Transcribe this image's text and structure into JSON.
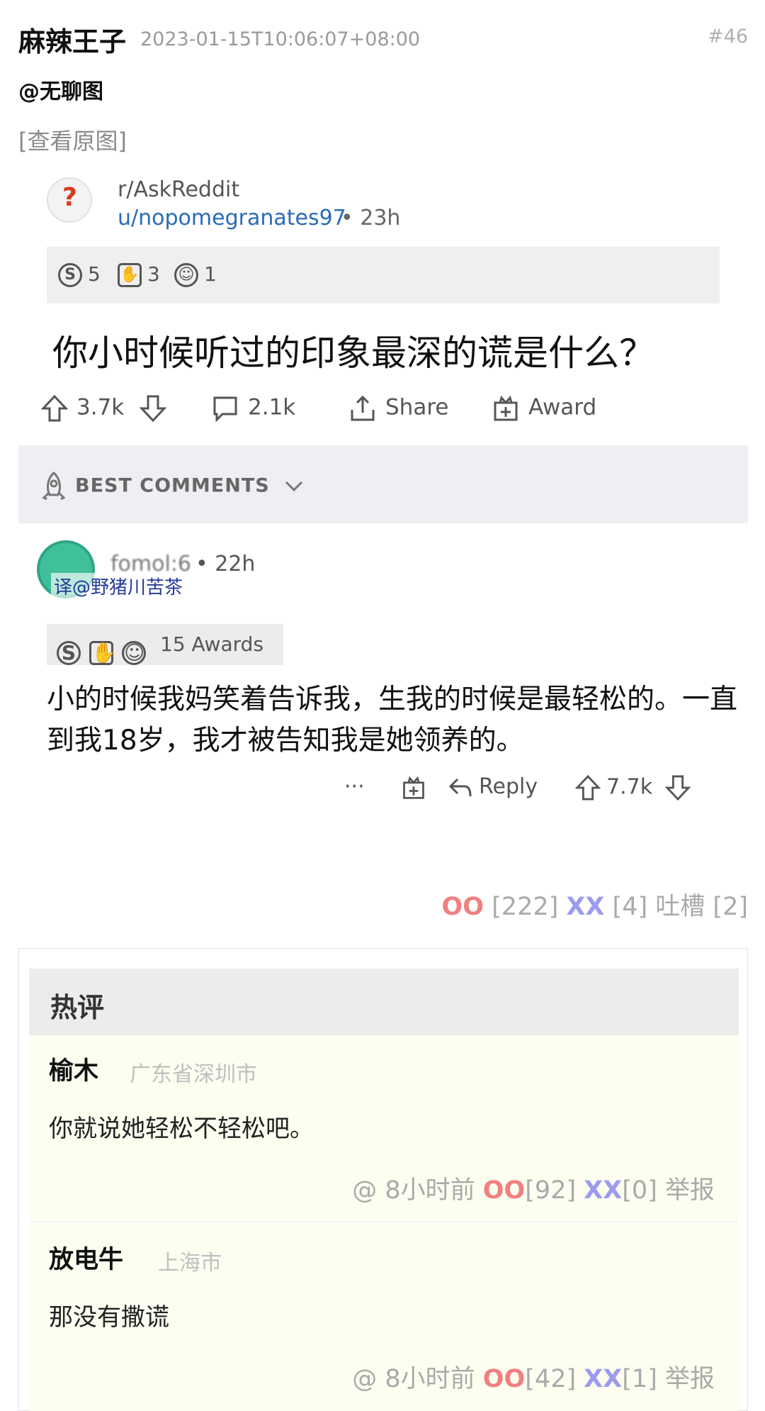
{
  "post": {
    "author": "麻辣王子",
    "timestamp": "2023-01-15T10:06:07+08:00",
    "number": "#46",
    "mention": "@无聊图",
    "view_original": "[查看原图]"
  },
  "reddit": {
    "subreddit": "r/AskReddit",
    "user": "u/nopomegranates97",
    "time": "• 23h",
    "awards": [
      {
        "icon": "silver-coin-icon",
        "count": "5"
      },
      {
        "icon": "helpful-award-icon",
        "count": "3"
      },
      {
        "icon": "wholesome-award-icon",
        "count": "1"
      }
    ],
    "question": "你小时候听过的印象最深的谎是什么？",
    "upvotes": "3.7k",
    "comments": "2.1k",
    "share": "Share",
    "award": "Award",
    "best_comments": "BEST COMMENTS",
    "comment": {
      "user_blur": "fomol:6",
      "time": "• 22h",
      "watermark": "译@野猪川苦茶",
      "awards_label": "15 Awards",
      "text": "小的时候我妈笑着告诉我，生我的时候是最轻松的。一直到我18岁，我才被告知我是她领养的。",
      "more": "···",
      "reply": "Reply",
      "votes": "7.7k"
    }
  },
  "votes": {
    "oo_label": "OO",
    "oo_count": "[222]",
    "xx_label": "XX",
    "xx_count": "[4]",
    "tucao_label": "吐槽",
    "tucao_count": "[2]"
  },
  "hot": {
    "title": "热评",
    "items": [
      {
        "name": "榆木",
        "location": "广东省深圳市",
        "text": "你就说她轻松不轻松吧。",
        "time": "@ 8小时前",
        "oo": "OO",
        "oo_count": "[92]",
        "xx": "XX",
        "xx_count": "[0]",
        "report": "举报"
      },
      {
        "name": "放电牛",
        "location": "上海市",
        "text": "那没有撒谎",
        "time": "@ 8小时前",
        "oo": "OO",
        "oo_count": "[42]",
        "xx": "XX",
        "xx_count": "[1]",
        "report": "举报"
      }
    ]
  },
  "colors": {
    "oo": "#f08080",
    "xx": "#9b9bef",
    "reddit_user": "#2a6bb5",
    "hot_bg": "#fdfdf0"
  }
}
